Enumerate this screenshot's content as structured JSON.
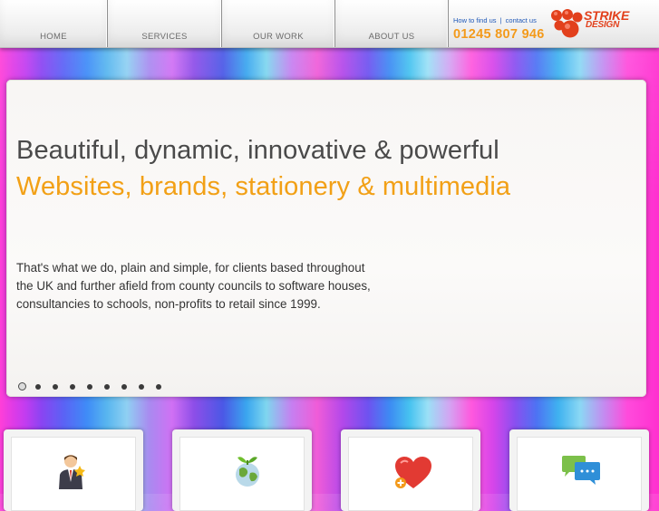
{
  "nav": {
    "items": [
      {
        "label": "HOME"
      },
      {
        "label": "SERVICES"
      },
      {
        "label": "OUR WORK"
      },
      {
        "label": "ABOUT US"
      }
    ]
  },
  "contact": {
    "find_us": "How to find us",
    "separator": "|",
    "contact_us": "contact us",
    "phone": "01245 807 946"
  },
  "logo": {
    "word1": "STRIKE",
    "word2": "DESIGN",
    "brand_color": "#e2401c"
  },
  "hero": {
    "headline": "Beautiful, dynamic, innovative & powerful",
    "subheadline": "Websites, brands, stationery & multimedia",
    "description": "That's what we do, plain and simple, for clients based throughout the UK and further afield from county councils to software houses, consultancies to schools, non-profits to retail since 1999.",
    "slide_count": 9,
    "active_slide": 1,
    "accent_color": "#f2a016"
  },
  "cards": [
    {
      "icon": "businessman-icon"
    },
    {
      "icon": "globe-icon"
    },
    {
      "icon": "heart-icon"
    },
    {
      "icon": "chat-bubbles-icon"
    }
  ]
}
